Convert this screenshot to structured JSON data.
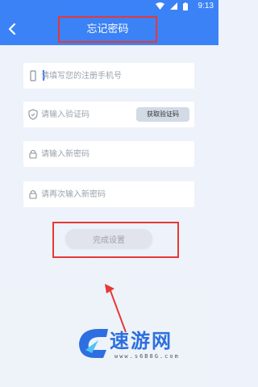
{
  "status_bar": {
    "time": "9:13"
  },
  "header": {
    "title": "忘记密码"
  },
  "form": {
    "phone_placeholder": "请填写您的注册手机号",
    "code_placeholder": "请输入验证码",
    "get_code_label": "获取验证码",
    "new_password_placeholder": "请输入新密码",
    "confirm_password_placeholder": "请再次输入新密码",
    "submit_label": "完成设置"
  },
  "watermark": {
    "brand": "速游网",
    "url": "www.s6B8G.com"
  },
  "colors": {
    "primary": "#3b82f6",
    "highlight": "#e53935"
  }
}
